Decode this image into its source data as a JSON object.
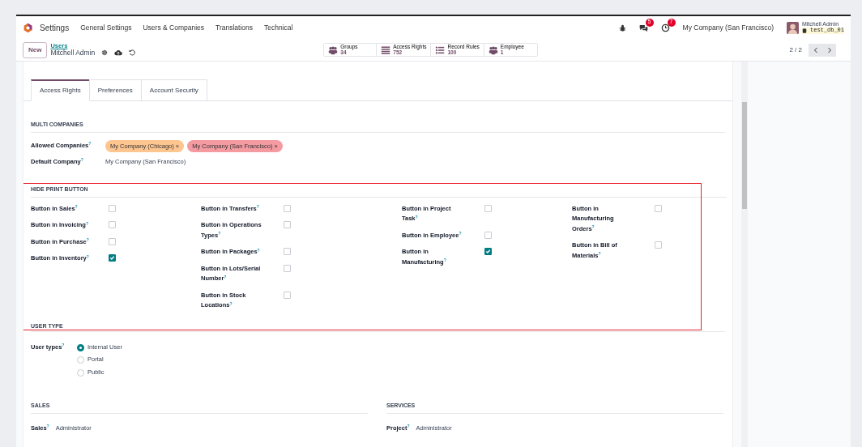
{
  "navbar": {
    "app": "Settings",
    "menus": [
      "General Settings",
      "Users & Companies",
      "Translations",
      "Technical"
    ],
    "messages_count": "5",
    "activities_count": "7",
    "company": "My Company (San Francisco)",
    "user": "Mitchell Admin",
    "database": "test_db_01"
  },
  "control_panel": {
    "new_button": "New",
    "breadcrumb": "Users",
    "record": "Mitchell Admin",
    "pager": "2 / 2",
    "smart_buttons": [
      {
        "kind": "people",
        "label": "Groups",
        "value": "34"
      },
      {
        "kind": "list",
        "label": "Access Rights",
        "value": "752"
      },
      {
        "kind": "bullets",
        "label": "Record Rules",
        "value": "100"
      },
      {
        "kind": "people",
        "label": "Employee",
        "value": "1"
      }
    ]
  },
  "tabs": [
    {
      "label": "Access Rights",
      "selected": true
    },
    {
      "label": "Preferences",
      "selected": false
    },
    {
      "label": "Account Security",
      "selected": false
    }
  ],
  "multi_companies": {
    "title": "MULTI COMPANIES",
    "allowed_label": "Allowed Companies$^{?}$",
    "allowed": [
      {
        "label": "My Company (Chicago)",
        "remove": "×",
        "color": "#fdc58f"
      },
      {
        "label": "My Company (San Francisco)",
        "remove": "×",
        "color": "#f49aa1"
      }
    ],
    "default_label": "Default Company$^{?}$",
    "default_value": "My Company (San Francisco)"
  },
  "hide_print": {
    "title": "HIDE PRINT BUTTON",
    "highlighted": true,
    "columns": [
      [
        {
          "label": "Button in Sales$^{?}$",
          "checked": false
        },
        {
          "label": "Button in Invoicing$^{?}$",
          "checked": false
        },
        {
          "label": "Button in Purchase$^{?}$",
          "checked": false
        },
        {
          "label": "Button in Inventory$^{?}$",
          "checked": true
        }
      ],
      [
        {
          "label": "Button in Transfers$^{?}$",
          "checked": false
        },
        {
          "label": "Button in Operations Types$^{?}$",
          "checked": false
        },
        {
          "label": "Button in Packages$^{?}$",
          "checked": false
        },
        {
          "label": "Button in Lots/Serial Number$^{?}$",
          "checked": false
        },
        {
          "label": "Button in Stock Locations$^{?}$",
          "checked": false
        }
      ],
      [
        {
          "label": "Button in Project Task$^{?}$",
          "checked": false
        },
        {
          "label": "Button in Employee$^{?}$",
          "checked": false
        },
        {
          "label": "Button in Manufacturing$^{?}$",
          "checked": true
        }
      ],
      [
        {
          "label": "Button in Manufacturing Orders$^{?}$",
          "checked": false
        },
        {
          "label": "Button in Bill of Materials$^{?}$",
          "checked": false
        }
      ]
    ]
  },
  "user_type": {
    "title": "USER TYPE",
    "label": "User types$^{?}$",
    "options": [
      {
        "label": "Internal User",
        "selected": true
      },
      {
        "label": "Portal",
        "selected": false
      },
      {
        "label": "Public",
        "selected": false
      }
    ]
  },
  "groups": [
    {
      "title": "SALES",
      "label": "Sales$^{?}$",
      "value": "Administrator"
    },
    {
      "title": "SERVICES",
      "label": "Project$^{?}$",
      "value": "Administrator"
    }
  ]
}
